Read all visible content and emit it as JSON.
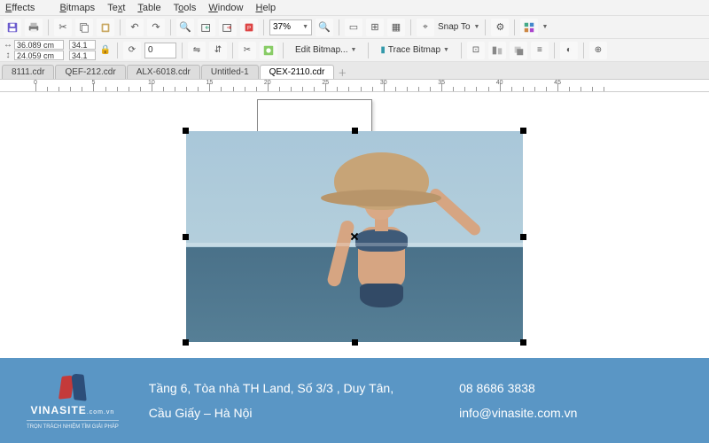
{
  "menu": {
    "items": [
      "Effects",
      "Bitmaps",
      "Text",
      "Table",
      "Tools",
      "Window",
      "Help"
    ]
  },
  "toolbar": {
    "zoom": "37%",
    "snap_label": "Snap To"
  },
  "propbar": {
    "x_label": "↔",
    "y_label": "↕",
    "x": "36.089 cm",
    "y": "24.059 cm",
    "pct1": "34.1",
    "pct2": "34.1",
    "rot": "0",
    "edit_bitmap": "Edit Bitmap...",
    "trace_bitmap": "Trace Bitmap"
  },
  "tabs": {
    "items": [
      "8111.cdr",
      "QEF-212.cdr",
      "ALX-6018.cdr",
      "Untitled-1",
      "QEX-2110.cdr"
    ],
    "active_index": 4
  },
  "ruler": {
    "marks": [
      0,
      5,
      10,
      15,
      20,
      25,
      30,
      35,
      40,
      45
    ]
  },
  "footer": {
    "brand": "VINASITE",
    "brand_domain": ".com.vn",
    "brand_tag": "TRỌN TRÁCH NHIỆM TÌM GIẢI PHÁP",
    "addr1": "Tầng 6, Tòa nhà TH Land, Số 3/3 , Duy Tân,",
    "addr2": "Cầu Giấy – Hà Nội",
    "phone": "08 8686 3838",
    "email": "info@vinasite.com.vn"
  }
}
